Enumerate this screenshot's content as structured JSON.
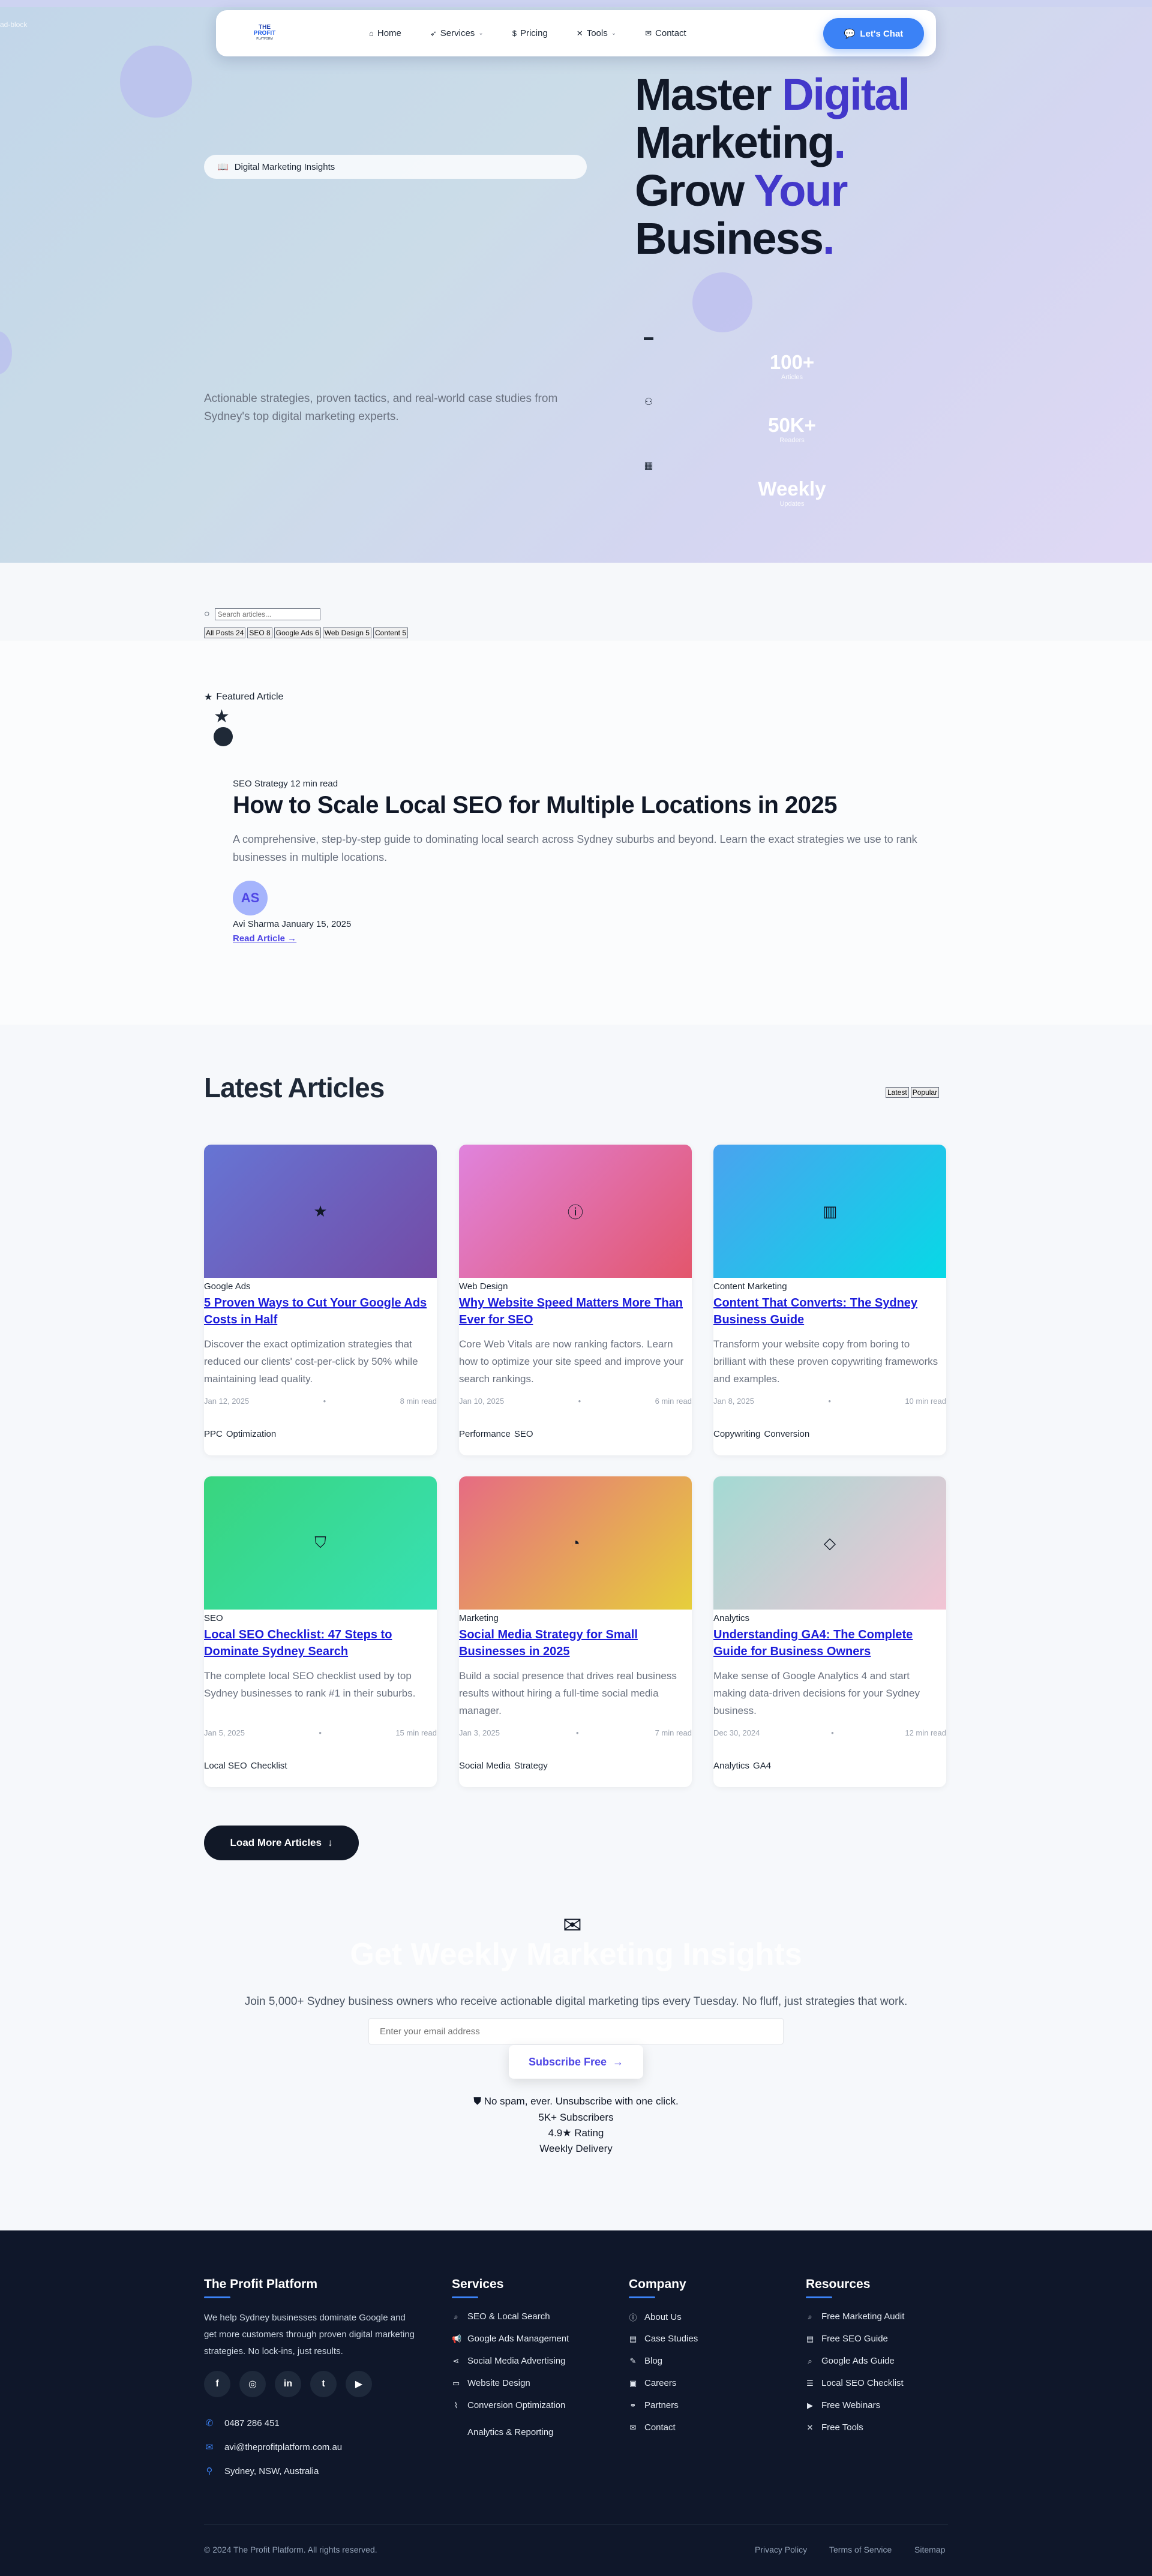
{
  "hero": {
    "corner_text": "ad-block",
    "badge": "Digital Marketing Insights",
    "title_l1a": "Master ",
    "title_l1b": "Digital",
    "title_l2a": "Marketing",
    "title_l2b": ".",
    "title_l3a": "Grow ",
    "title_l3b": "Your",
    "title_l4a": "Business",
    "title_l4b": ".",
    "subtitle": "Actionable strategies, proven tactics, and real-world case studies from Sydney's top digital marketing experts.",
    "stats": [
      {
        "value": "100+",
        "label": "Articles",
        "icon": "document-icon"
      },
      {
        "value": "50K+",
        "label": "Readers",
        "icon": "users-icon"
      },
      {
        "value": "Weekly",
        "label": "Updates",
        "icon": "calendar-icon"
      }
    ]
  },
  "nav": {
    "logo_line1": "THE",
    "logo_line2": "PROFIT",
    "logo_line3": "PLATFORM",
    "items": [
      {
        "label": "Home",
        "icon": "home-icon"
      },
      {
        "label": "Services",
        "icon": "rocket-icon"
      },
      {
        "label": "Pricing",
        "icon": "dollar-icon"
      },
      {
        "label": "Tools",
        "icon": "tools-icon"
      },
      {
        "label": "Contact",
        "icon": "envelope-icon"
      }
    ],
    "chat_label": "Let's Chat"
  },
  "search": {
    "placeholder": "Search articles...",
    "filters": [
      "All Posts 24",
      "SEO 8",
      "Google Ads 6",
      "Web Design 5",
      "Content 5"
    ]
  },
  "featured": {
    "label": "Featured Article",
    "meta": "SEO Strategy 12 min read",
    "title": "How to Scale Local SEO for Multiple Locations in 2025",
    "description": "A comprehensive, step-by-step guide to dominating local search across Sydney suburbs and beyond. Learn the exact strategies we use to rank businesses in multiple locations.",
    "avatar": "AS",
    "author": "Avi Sharma January 15, 2025",
    "read_label": "Read Article"
  },
  "latest": {
    "title": "Latest Articles",
    "sort": [
      "Latest",
      "Popular"
    ],
    "cards": [
      {
        "category": "Google Ads",
        "title": "5 Proven Ways to Cut Your Google Ads Costs in Half",
        "desc": "Discover the exact optimization strategies that reduced our clients' cost-per-click by 50% while maintaining lead quality.",
        "date": "Jan 12, 2025",
        "read": "8 min read",
        "tags": [
          "PPC",
          "Optimization"
        ],
        "icon": "star-icon",
        "gradient": [
          "#6675d4",
          "#744ba6"
        ]
      },
      {
        "category": "Web Design",
        "title": "Why Website Speed Matters More Than Ever for SEO",
        "desc": "Core Web Vitals are now ranking factors. Learn how to optimize your site speed and improve your search rankings.",
        "date": "Jan 10, 2025",
        "read": "6 min read",
        "tags": [
          "Performance",
          "SEO"
        ],
        "icon": "info-icon",
        "gradient": [
          "#e083dd",
          "#e3566c"
        ]
      },
      {
        "category": "Content Marketing",
        "title": "Content That Converts: The Sydney Business Guide",
        "desc": "Transform your website copy from boring to brilliant with these proven copywriting frameworks and examples.",
        "date": "Jan 8, 2025",
        "read": "10 min read",
        "tags": [
          "Copywriting",
          "Conversion"
        ],
        "icon": "chart-icon",
        "gradient": [
          "#4aa3ef",
          "#07d9e6"
        ]
      },
      {
        "category": "SEO",
        "title": "Local SEO Checklist: 47 Steps to Dominate Sydney Search",
        "desc": "The complete local SEO checklist used by top Sydney businesses to rank #1 in their suburbs.",
        "date": "Jan 5, 2025",
        "read": "15 min read",
        "tags": [
          "Local SEO",
          "Checklist"
        ],
        "icon": "shield-icon",
        "gradient": [
          "#39d57e",
          "#37e0b4"
        ]
      },
      {
        "category": "Marketing",
        "title": "Social Media Strategy for Small Businesses in 2025",
        "desc": "Build a social presence that drives real business results without hiring a full-time social media manager.",
        "date": "Jan 3, 2025",
        "read": "7 min read",
        "tags": [
          "Social Media",
          "Strategy"
        ],
        "icon": "clock-icon",
        "gradient": [
          "#e66b83",
          "#e6cf3b"
        ]
      },
      {
        "category": "Analytics",
        "title": "Understanding GA4: The Complete Guide for Business Owners",
        "desc": "Make sense of Google Analytics 4 and start making data-driven decisions for your Sydney business.",
        "date": "Dec 30, 2024",
        "read": "12 min read",
        "tags": [
          "Analytics",
          "GA4"
        ],
        "icon": "diamond-icon",
        "gradient": [
          "#a3dad3",
          "#f2c4d4"
        ]
      }
    ],
    "card_sep": "•",
    "load_more": "Load More Articles"
  },
  "newsletter": {
    "title": "Get Weekly Marketing Insights",
    "subtitle": "Join 5,000+ Sydney business owners who receive actionable digital marketing tips every Tuesday. No fluff, just strategies that work.",
    "input_placeholder": "Enter your email address",
    "button": "Subscribe Free",
    "note": "No spam, ever. Unsubscribe with one click.",
    "stat1": "5K+ Subscribers",
    "stat2": "4.9★ Rating",
    "stat3": "Weekly Delivery"
  },
  "footer": {
    "brand": "The Profit Platform",
    "about": "We help Sydney businesses dominate Google and get more customers through proven digital marketing strategies. No lock-ins, just results.",
    "social": [
      "f",
      "◎",
      "in",
      "t",
      "▶"
    ],
    "phone": "0487 286 451",
    "email": "avi@theprofitplatform.com.au",
    "location": "Sydney, NSW, Australia",
    "services_title": "Services",
    "services": [
      "SEO & Local Search",
      "Google Ads Management",
      "Social Media Advertising",
      "Website Design",
      "Conversion Optimization",
      "Analytics & Reporting"
    ],
    "company_title": "Company",
    "company": [
      "About Us",
      "Case Studies",
      "Blog",
      "Careers",
      "Partners",
      "Contact"
    ],
    "resources_title": "Resources",
    "resources": [
      "Free Marketing Audit",
      "Free SEO Guide",
      "Google Ads Guide",
      "Local SEO Checklist",
      "Free Webinars",
      "Free Tools"
    ],
    "copyright": "© 2024 The Profit Platform. All rights reserved.",
    "bottom_links": [
      "Privacy Policy",
      "Terms of Service",
      "Sitemap"
    ]
  }
}
